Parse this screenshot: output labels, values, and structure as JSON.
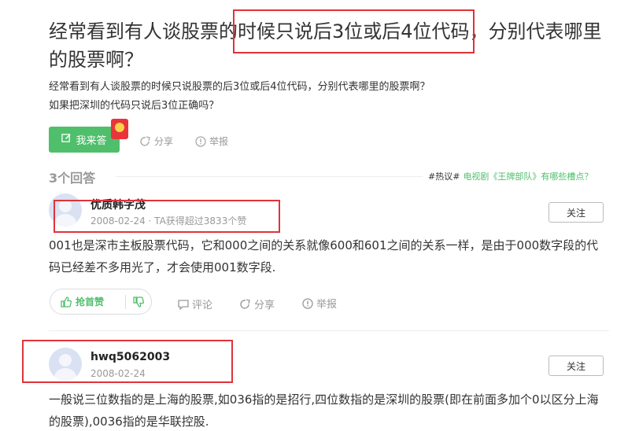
{
  "question": {
    "title": "经常看到有人谈股票的时候只说后3位或后4位代码，分别代表哪里的股票啊？",
    "description_lines": [
      "经常看到有人谈股票的时候只说股票的后3位或后4位代码，分别代表哪里的股票啊？",
      "如果把深圳的代码只说后3位正确吗？"
    ]
  },
  "actions": {
    "answer_label": "我来答",
    "share_label": "分享",
    "report_label": "举报"
  },
  "answers_header": {
    "count_label": "3个回答",
    "hot_tag": "#热议#",
    "hot_link": "电视剧《王牌部队》有哪些槽点？"
  },
  "answers": [
    {
      "user": "优质韩字茂",
      "meta": "2008-02-24 · TA获得超过3833个赞",
      "follow_label": "关注",
      "text": "001也是深市主板股票代码，它和000之间的关系就像600和601之间的关系一样，是由于000数字段的代码已经差不多用光了，才会使用001数字段.",
      "vote_label": "抢首赞",
      "comment_label": "评论",
      "share_label": "分享",
      "report_label": "举报"
    },
    {
      "user": "hwq5062003",
      "meta": "2008-02-24",
      "follow_label": "关注",
      "text": "一般说三位数指的是上海的股票,如036指的是招行,四位数指的是深圳的股票(即在前面多加个0以区分上海的股票),0036指的是华联控股."
    }
  ],
  "colors": {
    "accent": "#4fbf6b",
    "highlight": "#e0333a"
  }
}
